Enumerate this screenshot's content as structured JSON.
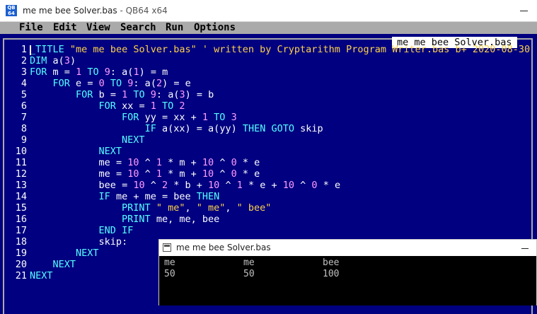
{
  "window": {
    "title": "me me bee Solver.bas",
    "app": " - QB64 x64",
    "icon_lines": [
      "QB",
      "64"
    ]
  },
  "menu": [
    {
      "label": "File"
    },
    {
      "label": "Edit"
    },
    {
      "label": "View"
    },
    {
      "label": "Search"
    },
    {
      "label": "Run"
    },
    {
      "label": "Options"
    }
  ],
  "editor": {
    "file_tab": "me me bee Solver.bas",
    "line_numbers": [
      "1",
      "2",
      "3",
      "4",
      "5",
      "6",
      "7",
      "8",
      "9",
      "10",
      "11",
      "12",
      "13",
      "14",
      "15",
      "16",
      "17",
      "18",
      "19",
      "20",
      "21"
    ],
    "code_lines": [
      "_TITLE \"me me bee Solver.bas\" ' written by Cryptarithm Program Writer.bas b+ 2020-08-30",
      "DIM a(3)",
      "FOR m = 1 TO 9: a(1) = m",
      "    FOR e = 0 TO 9: a(2) = e",
      "        FOR b = 1 TO 9: a(3) = b",
      "            FOR xx = 1 TO 2",
      "                FOR yy = xx + 1 TO 3",
      "                    IF a(xx) = a(yy) THEN GOTO skip",
      "                NEXT",
      "            NEXT",
      "            me = 10 ^ 1 * m + 10 ^ 0 * e",
      "            me = 10 ^ 1 * m + 10 ^ 0 * e",
      "            bee = 10 ^ 2 * b + 10 ^ 1 * e + 10 ^ 0 * e",
      "            IF me + me = bee THEN",
      "                PRINT \" me\", \" me\", \" bee\"",
      "                PRINT me, me, bee",
      "            END IF",
      "            skip:",
      "        NEXT",
      "    NEXT",
      "NEXT"
    ]
  },
  "output_window": {
    "title": "me me bee Solver.bas",
    "rows": [
      [
        "me",
        "me",
        "bee"
      ],
      [
        "50",
        "50",
        "100"
      ]
    ]
  }
}
